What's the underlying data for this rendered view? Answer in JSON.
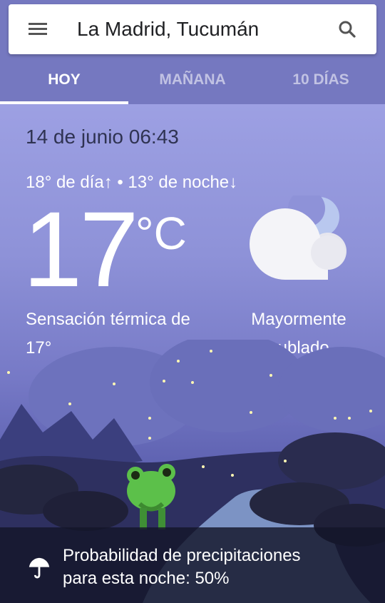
{
  "search": {
    "location": "La Madrid, Tucumán"
  },
  "tabs": [
    {
      "label": "HOY",
      "active": true
    },
    {
      "label": "MAÑANA",
      "active": false
    },
    {
      "label": "10 DÍAS",
      "active": false
    }
  ],
  "weather": {
    "date_time": "14 de junio 06:43",
    "high_low": "18° de día↑ • 13° de noche↓",
    "temperature": "17",
    "unit": "°C",
    "feels_like_line1": "Sensación térmica de",
    "feels_like_line2": "17°",
    "condition_line1": "Mayormente",
    "condition_line2": "nublado",
    "condition_icon": "partly-cloudy-night-icon"
  },
  "footer": {
    "icon": "umbrella-icon",
    "precip_line1": "Probabilidad de precipitaciones",
    "precip_line2": "para esta noche: 50%"
  },
  "colors": {
    "appbar": "#7578c0",
    "sky_top": "#9da0e3",
    "frog": "#5cc04a"
  }
}
